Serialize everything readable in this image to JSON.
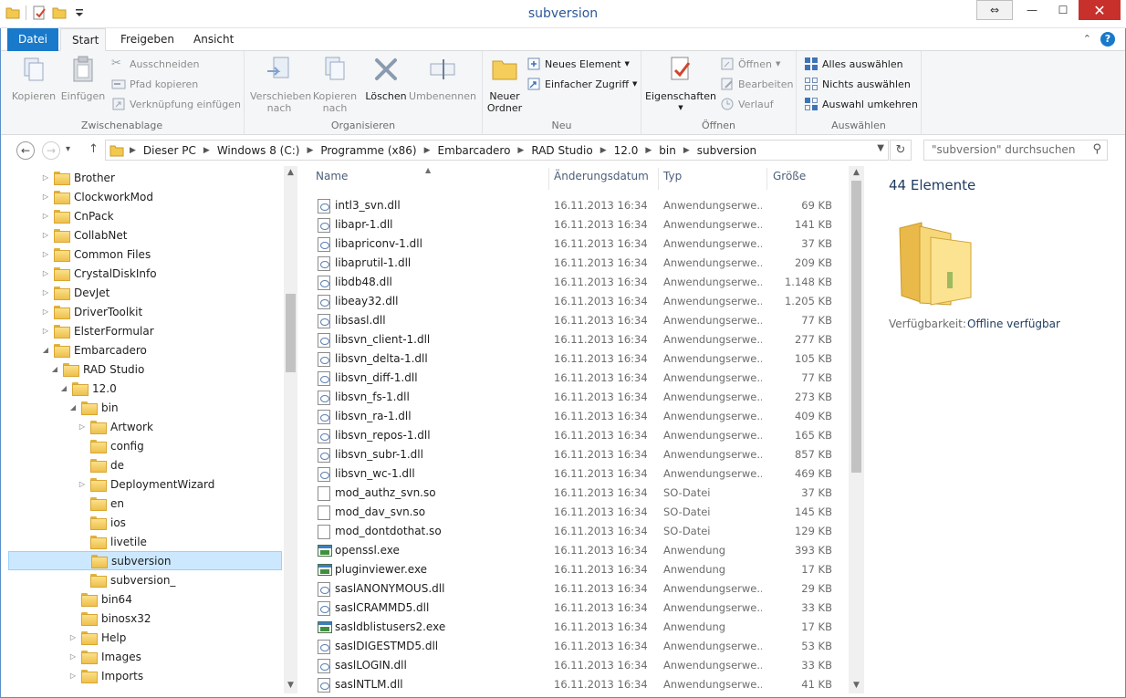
{
  "window": {
    "title": "subversion"
  },
  "ribbon_tabs": {
    "file": "Datei",
    "start": "Start",
    "share": "Freigeben",
    "view": "Ansicht"
  },
  "ribbon": {
    "clipboard": {
      "label": "Zwischenablage",
      "copy": "Kopieren",
      "paste": "Einfügen",
      "cut": "Ausschneiden",
      "copy_path": "Pfad kopieren",
      "paste_shortcut": "Verknüpfung einfügen"
    },
    "organize": {
      "label": "Organisieren",
      "move_to_1": "Verschieben",
      "move_to_2": "nach",
      "copy_to_1": "Kopieren",
      "copy_to_2": "nach",
      "delete": "Löschen",
      "rename": "Umbenennen"
    },
    "new": {
      "label": "Neu",
      "new_folder_1": "Neuer",
      "new_folder_2": "Ordner",
      "new_item": "Neues Element",
      "easy_access": "Einfacher Zugriff"
    },
    "open": {
      "label": "Öffnen",
      "properties": "Eigenschaften",
      "open": "Öffnen",
      "edit": "Bearbeiten",
      "history": "Verlauf"
    },
    "select": {
      "label": "Auswählen",
      "select_all": "Alles auswählen",
      "select_none": "Nichts auswählen",
      "invert": "Auswahl umkehren"
    }
  },
  "address": {
    "crumbs": [
      "Dieser PC",
      "Windows 8 (C:)",
      "Programme (x86)",
      "Embarcadero",
      "RAD Studio",
      "12.0",
      "bin",
      "subversion"
    ]
  },
  "search": {
    "placeholder": "\"subversion\" durchsuchen"
  },
  "tree": [
    {
      "label": "Brother",
      "level": 0,
      "arrow": "closed"
    },
    {
      "label": "ClockworkMod",
      "level": 0,
      "arrow": "closed"
    },
    {
      "label": "CnPack",
      "level": 0,
      "arrow": "closed"
    },
    {
      "label": "CollabNet",
      "level": 0,
      "arrow": "closed"
    },
    {
      "label": "Common Files",
      "level": 0,
      "arrow": "closed"
    },
    {
      "label": "CrystalDiskInfo",
      "level": 0,
      "arrow": "closed"
    },
    {
      "label": "DevJet",
      "level": 0,
      "arrow": "closed"
    },
    {
      "label": "DriverToolkit",
      "level": 0,
      "arrow": "closed"
    },
    {
      "label": "ElsterFormular",
      "level": 0,
      "arrow": "closed"
    },
    {
      "label": "Embarcadero",
      "level": 0,
      "arrow": "open"
    },
    {
      "label": "RAD Studio",
      "level": 1,
      "arrow": "open"
    },
    {
      "label": "12.0",
      "level": 2,
      "arrow": "open"
    },
    {
      "label": "bin",
      "level": 3,
      "arrow": "open"
    },
    {
      "label": "Artwork",
      "level": 4,
      "arrow": "closed"
    },
    {
      "label": "config",
      "level": 4,
      "arrow": "none"
    },
    {
      "label": "de",
      "level": 4,
      "arrow": "none"
    },
    {
      "label": "DeploymentWizard",
      "level": 4,
      "arrow": "closed"
    },
    {
      "label": "en",
      "level": 4,
      "arrow": "none"
    },
    {
      "label": "ios",
      "level": 4,
      "arrow": "none"
    },
    {
      "label": "livetile",
      "level": 4,
      "arrow": "none"
    },
    {
      "label": "subversion",
      "level": 4,
      "arrow": "none",
      "selected": true
    },
    {
      "label": "subversion_",
      "level": 4,
      "arrow": "none"
    },
    {
      "label": "bin64",
      "level": 3,
      "arrow": "none"
    },
    {
      "label": "binosx32",
      "level": 3,
      "arrow": "none"
    },
    {
      "label": "Help",
      "level": 3,
      "arrow": "closed"
    },
    {
      "label": "Images",
      "level": 3,
      "arrow": "closed"
    },
    {
      "label": "Imports",
      "level": 3,
      "arrow": "closed"
    }
  ],
  "columns": {
    "name": "Name",
    "date": "Änderungsdatum",
    "type": "Typ",
    "size": "Größe"
  },
  "files": [
    {
      "name": "intl3_svn.dll",
      "date": "16.11.2013 16:34",
      "type": "Anwendungserwe...",
      "size": "69 KB",
      "icon": "dll"
    },
    {
      "name": "libapr-1.dll",
      "date": "16.11.2013 16:34",
      "type": "Anwendungserwe...",
      "size": "141 KB",
      "icon": "dll"
    },
    {
      "name": "libapriconv-1.dll",
      "date": "16.11.2013 16:34",
      "type": "Anwendungserwe...",
      "size": "37 KB",
      "icon": "dll"
    },
    {
      "name": "libaprutil-1.dll",
      "date": "16.11.2013 16:34",
      "type": "Anwendungserwe...",
      "size": "209 KB",
      "icon": "dll"
    },
    {
      "name": "libdb48.dll",
      "date": "16.11.2013 16:34",
      "type": "Anwendungserwe...",
      "size": "1.148 KB",
      "icon": "dll"
    },
    {
      "name": "libeay32.dll",
      "date": "16.11.2013 16:34",
      "type": "Anwendungserwe...",
      "size": "1.205 KB",
      "icon": "dll"
    },
    {
      "name": "libsasl.dll",
      "date": "16.11.2013 16:34",
      "type": "Anwendungserwe...",
      "size": "77 KB",
      "icon": "dll"
    },
    {
      "name": "libsvn_client-1.dll",
      "date": "16.11.2013 16:34",
      "type": "Anwendungserwe...",
      "size": "277 KB",
      "icon": "dll"
    },
    {
      "name": "libsvn_delta-1.dll",
      "date": "16.11.2013 16:34",
      "type": "Anwendungserwe...",
      "size": "105 KB",
      "icon": "dll"
    },
    {
      "name": "libsvn_diff-1.dll",
      "date": "16.11.2013 16:34",
      "type": "Anwendungserwe...",
      "size": "77 KB",
      "icon": "dll"
    },
    {
      "name": "libsvn_fs-1.dll",
      "date": "16.11.2013 16:34",
      "type": "Anwendungserwe...",
      "size": "273 KB",
      "icon": "dll"
    },
    {
      "name": "libsvn_ra-1.dll",
      "date": "16.11.2013 16:34",
      "type": "Anwendungserwe...",
      "size": "409 KB",
      "icon": "dll"
    },
    {
      "name": "libsvn_repos-1.dll",
      "date": "16.11.2013 16:34",
      "type": "Anwendungserwe...",
      "size": "165 KB",
      "icon": "dll"
    },
    {
      "name": "libsvn_subr-1.dll",
      "date": "16.11.2013 16:34",
      "type": "Anwendungserwe...",
      "size": "857 KB",
      "icon": "dll"
    },
    {
      "name": "libsvn_wc-1.dll",
      "date": "16.11.2013 16:34",
      "type": "Anwendungserwe...",
      "size": "469 KB",
      "icon": "dll"
    },
    {
      "name": "mod_authz_svn.so",
      "date": "16.11.2013 16:34",
      "type": "SO-Datei",
      "size": "37 KB",
      "icon": "file"
    },
    {
      "name": "mod_dav_svn.so",
      "date": "16.11.2013 16:34",
      "type": "SO-Datei",
      "size": "145 KB",
      "icon": "file"
    },
    {
      "name": "mod_dontdothat.so",
      "date": "16.11.2013 16:34",
      "type": "SO-Datei",
      "size": "129 KB",
      "icon": "file"
    },
    {
      "name": "openssl.exe",
      "date": "16.11.2013 16:34",
      "type": "Anwendung",
      "size": "393 KB",
      "icon": "exe"
    },
    {
      "name": "pluginviewer.exe",
      "date": "16.11.2013 16:34",
      "type": "Anwendung",
      "size": "17 KB",
      "icon": "exe"
    },
    {
      "name": "saslANONYMOUS.dll",
      "date": "16.11.2013 16:34",
      "type": "Anwendungserwe...",
      "size": "29 KB",
      "icon": "dll"
    },
    {
      "name": "saslCRAMMD5.dll",
      "date": "16.11.2013 16:34",
      "type": "Anwendungserwe...",
      "size": "33 KB",
      "icon": "dll"
    },
    {
      "name": "sasldblistusers2.exe",
      "date": "16.11.2013 16:34",
      "type": "Anwendung",
      "size": "17 KB",
      "icon": "exe"
    },
    {
      "name": "saslDIGESTMD5.dll",
      "date": "16.11.2013 16:34",
      "type": "Anwendungserwe...",
      "size": "53 KB",
      "icon": "dll"
    },
    {
      "name": "saslLOGIN.dll",
      "date": "16.11.2013 16:34",
      "type": "Anwendungserwe...",
      "size": "33 KB",
      "icon": "dll"
    },
    {
      "name": "saslNTLM.dll",
      "date": "16.11.2013 16:34",
      "type": "Anwendungserwe...",
      "size": "41 KB",
      "icon": "dll"
    }
  ],
  "details": {
    "count": "44 Elemente",
    "availability_label": "Verfügbarkeit:",
    "availability_value": "Offline verfügbar"
  }
}
